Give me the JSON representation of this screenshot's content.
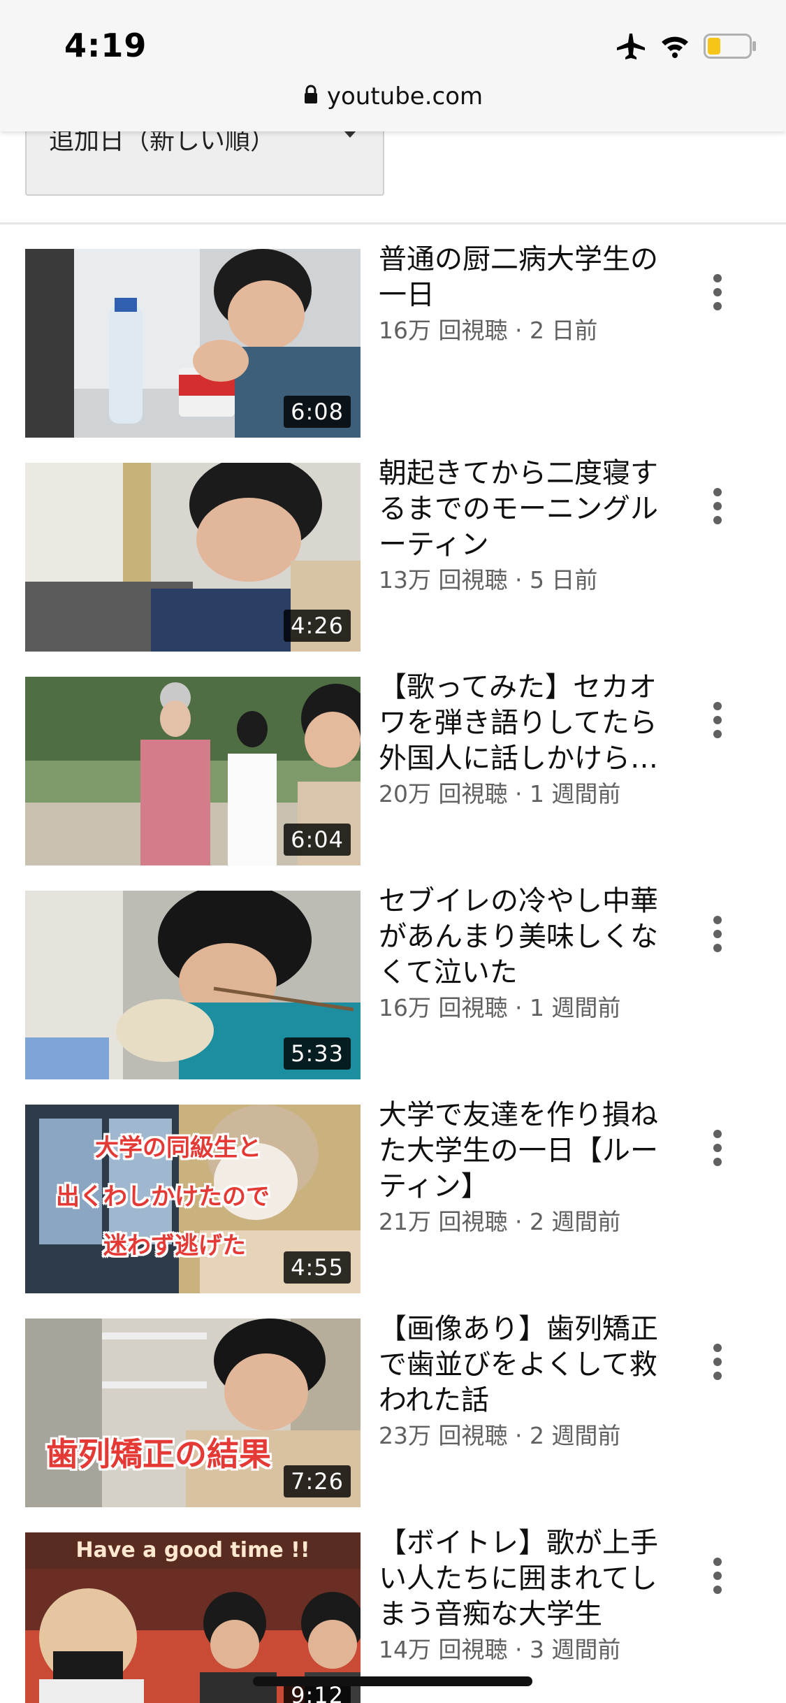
{
  "status_bar": {
    "time": "4:19",
    "icons": [
      "airplane-icon",
      "wifi-icon",
      "battery-icon"
    ],
    "battery_color": "#f5c518"
  },
  "browser": {
    "url": "youtube.com",
    "lock_icon": "lock-icon"
  },
  "sort": {
    "label": "追加日（新しい順）",
    "caret_icon": "caret-down-icon"
  },
  "colors": {
    "header_bg": "#f6f6f6",
    "meta_text": "#606060",
    "duration_bg": "#000000",
    "caption_red": "#e53935"
  },
  "videos": [
    {
      "title": "普通の厨二病大学生の一日",
      "stats": "16万 回視聴 · 2 日前",
      "duration": "6:08",
      "caption": ""
    },
    {
      "title": "朝起きてから二度寝するまでのモーニングルーティン",
      "stats": "13万 回視聴 · 5 日前",
      "duration": "4:26",
      "caption": ""
    },
    {
      "title": "【歌ってみた】セカオワを弾き語りしてたら外国人に話しかけられた",
      "stats": "20万 回視聴 · 1 週間前",
      "duration": "6:04",
      "caption": ""
    },
    {
      "title": "セブイレの冷やし中華があんまり美味しくなくて泣いた",
      "stats": "16万 回視聴 · 1 週間前",
      "duration": "5:33",
      "caption": ""
    },
    {
      "title": "大学で友達を作り損ねた大学生の一日【ルーティン】",
      "stats": "21万 回視聴 · 2 週間前",
      "duration": "4:55",
      "caption_lines": [
        "大学の同級生と",
        "出くわしかけたので",
        "迷わず逃げた"
      ]
    },
    {
      "title": "【画像あり】歯列矯正で歯並びをよくして救われた話",
      "stats": "23万 回視聴 · 2 週間前",
      "duration": "7:26",
      "caption": "歯列矯正の結果"
    },
    {
      "title": "【ボイトレ】歌が上手い人たちに囲まれてしまう音痴な大学生",
      "stats": "14万 回視聴 · 3 週間前",
      "duration": "9:12",
      "banner": "Have a good time !!"
    }
  ]
}
